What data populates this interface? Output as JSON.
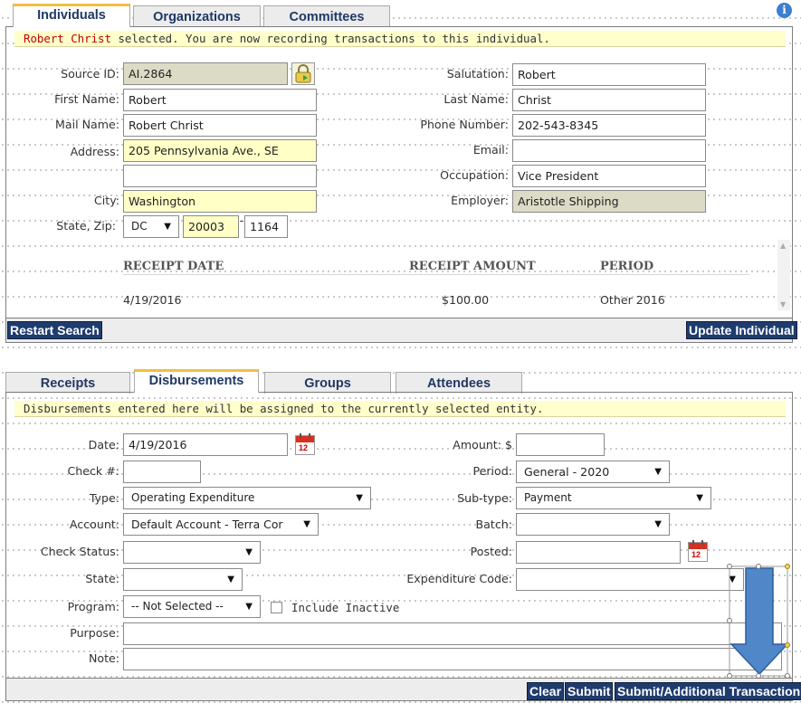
{
  "top_tabs": [
    {
      "label": "Individuals",
      "active": true
    },
    {
      "label": "Organizations",
      "active": false
    },
    {
      "label": "Committees",
      "active": false
    }
  ],
  "info_icon": "info-circle-icon",
  "top_banner": {
    "name": "Robert Christ",
    "text": " selected. You are now recording transactions to this individual."
  },
  "individual": {
    "source_id": {
      "label": "Source ID:",
      "value": "AI.2864"
    },
    "first_name": {
      "label": "First Name:",
      "value": "Robert"
    },
    "mail_name": {
      "label": "Mail Name:",
      "value": "Robert Christ"
    },
    "address": {
      "label": "Address:",
      "line1": "205 Pennsylvania Ave., SE",
      "line2": ""
    },
    "city": {
      "label": "City:",
      "value": "Washington"
    },
    "state_zip": {
      "label": "State, Zip:",
      "state": "DC",
      "zip": "20003",
      "zip4": "1164"
    },
    "salutation": {
      "label": "Salutation:",
      "value": "Robert"
    },
    "last_name": {
      "label": "Last Name:",
      "value": "Christ"
    },
    "phone": {
      "label": "Phone Number:",
      "value": "202-543-8345"
    },
    "email": {
      "label": "Email:",
      "value": ""
    },
    "occupation": {
      "label": "Occupation:",
      "value": "Vice President"
    },
    "employer": {
      "label": "Employer:",
      "value": "Aristotle Shipping"
    }
  },
  "receipts_table": {
    "columns": [
      "RECEIPT DATE",
      "RECEIPT AMOUNT",
      "PERIOD"
    ],
    "rows": [
      [
        "4/19/2016",
        "$100.00",
        "Other 2016"
      ]
    ]
  },
  "top_bar": {
    "restart": "Restart Search",
    "update": "Update Individual"
  },
  "bottom_tabs": [
    {
      "label": "Receipts",
      "active": false
    },
    {
      "label": "Disbursements",
      "active": true
    },
    {
      "label": "Groups",
      "active": false
    },
    {
      "label": "Attendees",
      "active": false
    }
  ],
  "bottom_banner": "Disbursements entered here will be assigned to the currently selected entity.",
  "disbursement": {
    "date": {
      "label": "Date:",
      "value": "4/19/2016"
    },
    "check_no": {
      "label": "Check #:",
      "value": ""
    },
    "type": {
      "label": "Type:",
      "value": "Operating Expenditure"
    },
    "account": {
      "label": "Account:",
      "value": "Default Account - Terra Cor"
    },
    "check_status": {
      "label": "Check Status:",
      "value": ""
    },
    "state": {
      "label": "State:",
      "value": ""
    },
    "program": {
      "label": "Program:",
      "value": "-- Not Selected --"
    },
    "include_inactive": {
      "label": "Include Inactive",
      "checked": false
    },
    "purpose": {
      "label": "Purpose:",
      "value": ""
    },
    "note": {
      "label": "Note:",
      "value": ""
    },
    "amount": {
      "label": "Amount: $",
      "value": ""
    },
    "period": {
      "label": "Period:",
      "value": "General - 2020"
    },
    "subtype": {
      "label": "Sub-type:",
      "value": "Payment"
    },
    "batch": {
      "label": "Batch:",
      "value": ""
    },
    "posted": {
      "label": "Posted:",
      "value": ""
    },
    "expenditure_code": {
      "label": "Expenditure Code:",
      "value": ""
    }
  },
  "calendar_day": "12",
  "bottom_bar": {
    "clear": "Clear",
    "submit": "Submit",
    "submit_additional": "Submit/Additional Transaction"
  },
  "colors": {
    "accent_navy": "#1f3c6e",
    "banner_yellow": "#ffffcc",
    "arrow_blue": "#4f87c9",
    "error_red": "#c00000"
  }
}
